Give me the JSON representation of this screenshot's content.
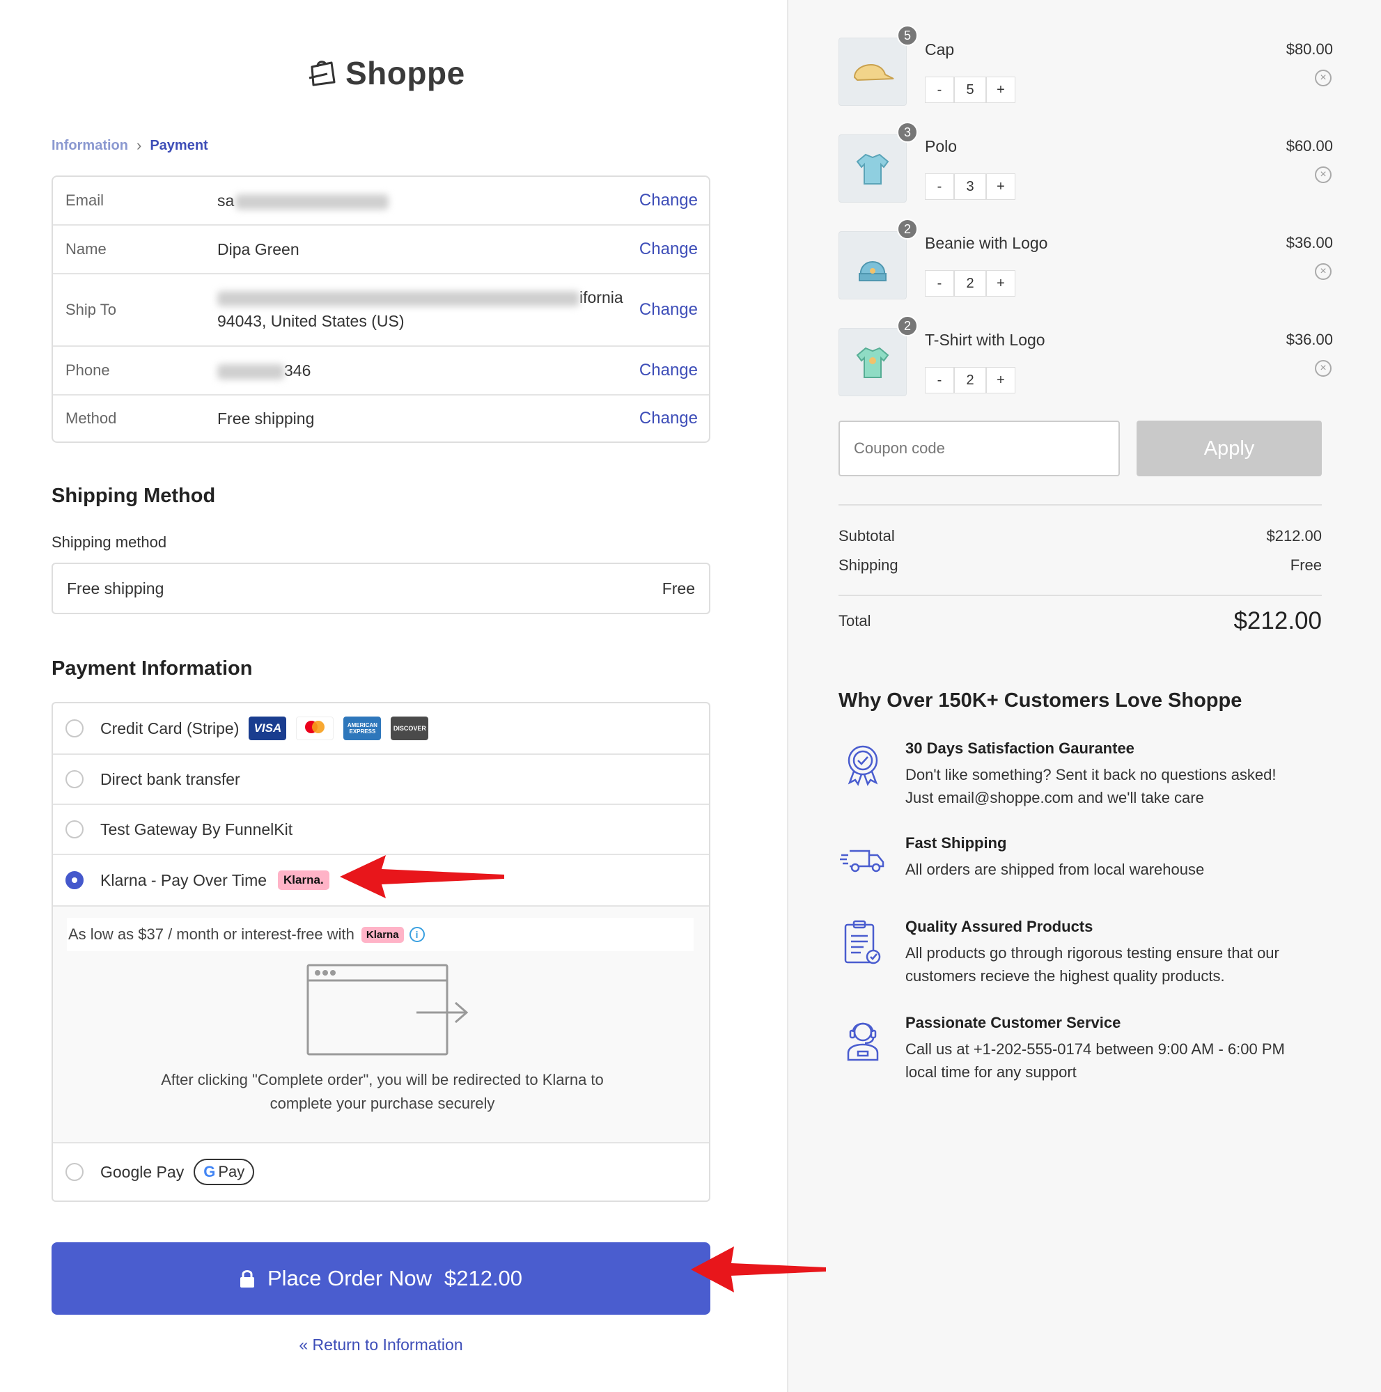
{
  "brand": {
    "name": "Shoppe"
  },
  "breadcrumb": {
    "step1": "Information",
    "step2": "Payment"
  },
  "info_rows": {
    "email": {
      "label": "Email",
      "value": "sa",
      "change": "Change"
    },
    "name": {
      "label": "Name",
      "value": "Dipa Green",
      "change": "Change"
    },
    "ship_to": {
      "label": "Ship To",
      "value_line1_tail": "ifornia",
      "value_line2": "94043, United States (US)",
      "change": "Change"
    },
    "phone": {
      "label": "Phone",
      "value_tail": "346",
      "change": "Change"
    },
    "method": {
      "label": "Method",
      "value": "Free shipping",
      "change": "Change"
    }
  },
  "shipping": {
    "title": "Shipping Method",
    "label": "Shipping method",
    "option": "Free shipping",
    "price": "Free"
  },
  "payment": {
    "title": "Payment Information",
    "credit_card": "Credit Card (Stripe)",
    "bank": "Direct bank transfer",
    "test_gateway": "Test Gateway By FunnelKit",
    "klarna": "Klarna - Pay Over Time",
    "klarna_badge": "Klarna.",
    "klarna_badge_small": "Klarna",
    "klarna_strip": "As low as $37 / month or interest-free with",
    "redirect_line1": "After clicking \"Complete order\", you will be redirected to Klarna to",
    "redirect_line2": "complete your purchase securely",
    "google_pay": "Google Pay",
    "gpay_badge": "Pay",
    "selected": "klarna",
    "card_logos": [
      "VISA",
      "mastercard",
      "AMERICAN EXPRESS",
      "DISCOVER"
    ]
  },
  "place_order": {
    "label": "Place Order Now",
    "amount": "$212.00"
  },
  "return_link": "« Return to Information",
  "cart": {
    "items": [
      {
        "name": "Cap",
        "price": "$80.00",
        "qty": "5"
      },
      {
        "name": "Polo",
        "price": "$60.00",
        "qty": "3"
      },
      {
        "name": "Beanie with Logo",
        "price": "$36.00",
        "qty": "2"
      },
      {
        "name": "T-Shirt with Logo",
        "price": "$36.00",
        "qty": "2"
      }
    ],
    "minus": "-",
    "plus": "+",
    "coupon_placeholder": "Coupon code",
    "apply_label": "Apply",
    "subtotal_label": "Subtotal",
    "subtotal_value": "$212.00",
    "shipping_label": "Shipping",
    "shipping_value": "Free",
    "total_label": "Total",
    "total_value": "$212.00"
  },
  "why": {
    "title": "Why Over 150K+ Customers Love Shoppe",
    "features": [
      {
        "title": "30 Days Satisfaction Gaurantee",
        "desc1": "Don't like something? Sent it back no questions asked!",
        "desc2": "Just email@shoppe.com and we'll take care"
      },
      {
        "title": "Fast Shipping",
        "desc1": "All orders are shipped from local warehouse",
        "desc2": ""
      },
      {
        "title": "Quality Assured Products",
        "desc1": "All products go through rigorous testing ensure that our",
        "desc2": "customers recieve the highest quality products."
      },
      {
        "title": "Passionate Customer Service",
        "desc1": "Call us at +1-202-555-0174 between 9:00 AM - 6:00 PM",
        "desc2": "local time for any support"
      }
    ]
  },
  "colors": {
    "accent": "#4a5dcf",
    "link": "#3e4eb8",
    "arrow": "#e8161b",
    "klarna_pink": "#ffb3c7"
  }
}
